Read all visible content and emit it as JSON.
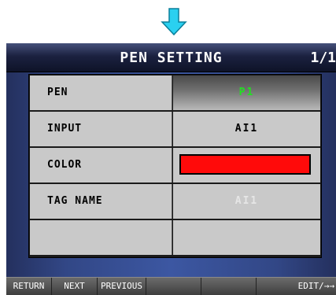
{
  "arrow": {
    "icon": "down-arrow-icon",
    "color": "#2ad0f0"
  },
  "header": {
    "title": "PEN SETTING",
    "page": "1/1"
  },
  "rows": [
    {
      "label": "PEN",
      "value": "P1"
    },
    {
      "label": "INPUT",
      "value": "AI1"
    },
    {
      "label": "COLOR",
      "value": "",
      "swatch": "#ff0a0a"
    },
    {
      "label": "TAG NAME",
      "value": "AI1"
    },
    {
      "label": "",
      "value": ""
    }
  ],
  "footer": {
    "buttons": [
      "RETURN",
      "NEXT",
      "PREVIOUS",
      "",
      "",
      "EDIT/→→"
    ]
  }
}
